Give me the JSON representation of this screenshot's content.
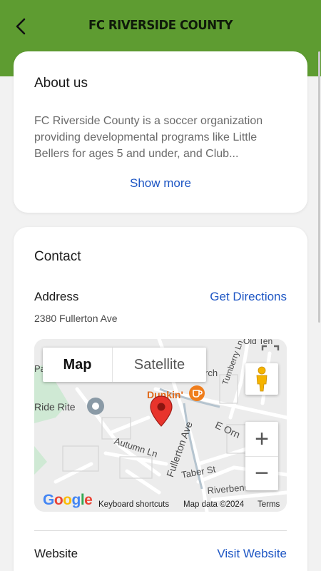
{
  "header": {
    "title": "FC RIVERSIDE COUNTY",
    "back_icon": "chevron-left-icon",
    "color": "#5e9c31"
  },
  "about": {
    "title": "About us",
    "text": "FC Riverside County is a soccer organization providing developmental programs like Little Bellers for ages 5 and under, and Club...",
    "show_more": "Show more"
  },
  "contact": {
    "title": "Contact",
    "address_label": "Address",
    "directions_label": "Get Directions",
    "address": "2380 Fullerton Ave",
    "website_label": "Website",
    "visit_label": "Visit Website",
    "link_color": "#1e56c4"
  },
  "map": {
    "map_tab": "Map",
    "satellite_tab": "Satellite",
    "zoom_in": "+",
    "zoom_out": "−",
    "labels": {
      "old_ten": "Old Ten",
      "park": "Park",
      "church": "rch",
      "turnberry": "Turnberry Ln",
      "ride_rite": "Ride Rite",
      "dunkin": "Dunkin'",
      "e_orn": "E Orn",
      "fullerton": "Fullerton Ave",
      "autumn": "Autumn Ln",
      "taber": "Taber St",
      "riverbend": "Riverbend Cir"
    },
    "google": "Google",
    "keyboard_shortcuts": "Keyboard shortcuts",
    "map_data": "Map data ©2024",
    "terms": "Terms"
  }
}
